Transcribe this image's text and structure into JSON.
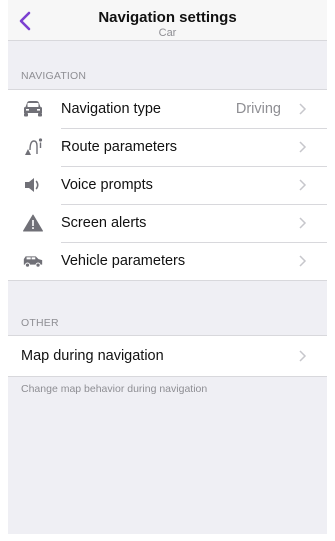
{
  "header": {
    "title": "Navigation settings",
    "subtitle": "Car",
    "back_icon": "chevron-left-icon"
  },
  "sections": [
    {
      "header": "NAVIGATION",
      "items": [
        {
          "label": "Navigation type",
          "value": "Driving",
          "icon": "car-icon"
        },
        {
          "label": "Route parameters",
          "value": "",
          "icon": "route-icon"
        },
        {
          "label": "Voice prompts",
          "value": "",
          "icon": "speaker-icon"
        },
        {
          "label": "Screen alerts",
          "value": "",
          "icon": "warning-icon"
        },
        {
          "label": "Vehicle parameters",
          "value": "",
          "icon": "vehicle-icon"
        }
      ]
    },
    {
      "header": "OTHER",
      "items": [
        {
          "label": "Map during navigation",
          "value": ""
        }
      ],
      "footer": "Change map behavior during navigation"
    }
  ],
  "colors": {
    "accent": "#7b3fd0",
    "icon": "#707077",
    "chevron": "#c7c7cc",
    "background": "#efeff4"
  }
}
